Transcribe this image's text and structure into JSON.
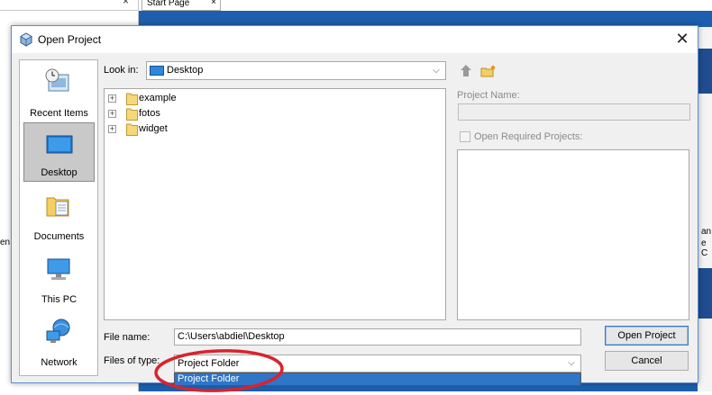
{
  "background": {
    "tab_label": "Start Page",
    "tab_close": "×",
    "panel_close": "×",
    "left_text": "en",
    "right_texts": [
      "an",
      "e C"
    ]
  },
  "dialog": {
    "title": "Open Project",
    "close_glyph": "✕",
    "places": [
      {
        "label": "Recent Items",
        "icon": "recent-items-icon"
      },
      {
        "label": "Desktop",
        "icon": "desktop-icon",
        "selected": true
      },
      {
        "label": "Documents",
        "icon": "documents-icon"
      },
      {
        "label": "This PC",
        "icon": "this-pc-icon"
      },
      {
        "label": "Network",
        "icon": "network-icon"
      }
    ],
    "look_in": {
      "label": "Look in:",
      "value": "Desktop"
    },
    "tree": [
      {
        "name": "example",
        "expander": "+"
      },
      {
        "name": "fotos",
        "expander": "+"
      },
      {
        "name": "widget",
        "expander": "+"
      }
    ],
    "project_name_label": "Project Name:",
    "open_required_label": "Open Required Projects:",
    "file_name": {
      "label": "File name:",
      "value": "C:\\Users\\abdiel\\Desktop"
    },
    "files_of_type": {
      "label": "Files of type:",
      "value": "Project Folder",
      "options": [
        "Project Folder"
      ]
    },
    "buttons": {
      "open": "Open Project",
      "cancel": "Cancel"
    },
    "colors": {
      "accent": "#2f75c8",
      "highlight_circle": "#d9232d",
      "ide_background": "#1d5fae"
    }
  }
}
